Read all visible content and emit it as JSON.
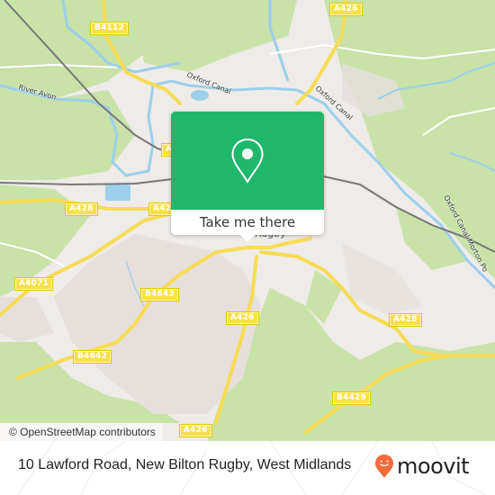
{
  "map": {
    "attribution": "© OpenStreetMap contributors",
    "road_labels": [
      {
        "id": "b4112",
        "text": "B4112"
      },
      {
        "id": "a426-top",
        "text": "A426"
      },
      {
        "id": "a428-left",
        "text": "A428"
      },
      {
        "id": "a42-mid",
        "text": "A42"
      },
      {
        "id": "a4-left",
        "text": "A4"
      },
      {
        "id": "a4071",
        "text": "A4071"
      },
      {
        "id": "b4642-upper",
        "text": "B4642"
      },
      {
        "id": "b4642-lower",
        "text": "B4642"
      },
      {
        "id": "a426-mid",
        "text": "A426"
      },
      {
        "id": "a428-right",
        "text": "A428"
      },
      {
        "id": "b4429",
        "text": "B4429"
      },
      {
        "id": "a426-bottom",
        "text": "A426"
      }
    ],
    "place_labels": {
      "river_avon": "River Avon",
      "oxford_canal_1": "Oxford Canal",
      "oxford_canal_2": "Oxford Canal",
      "oxford_canal_morton": "Oxford Canal Morton Po",
      "rugby": "Rugby"
    }
  },
  "popup": {
    "icon": "location-pin-icon",
    "button_label": "Take me there",
    "color": "#1fb86a"
  },
  "footer": {
    "address": "10 Lawford Road, New Bilton Rugby, West Midlands",
    "brand_name": "moovit",
    "brand_color": "#f26b3a"
  }
}
